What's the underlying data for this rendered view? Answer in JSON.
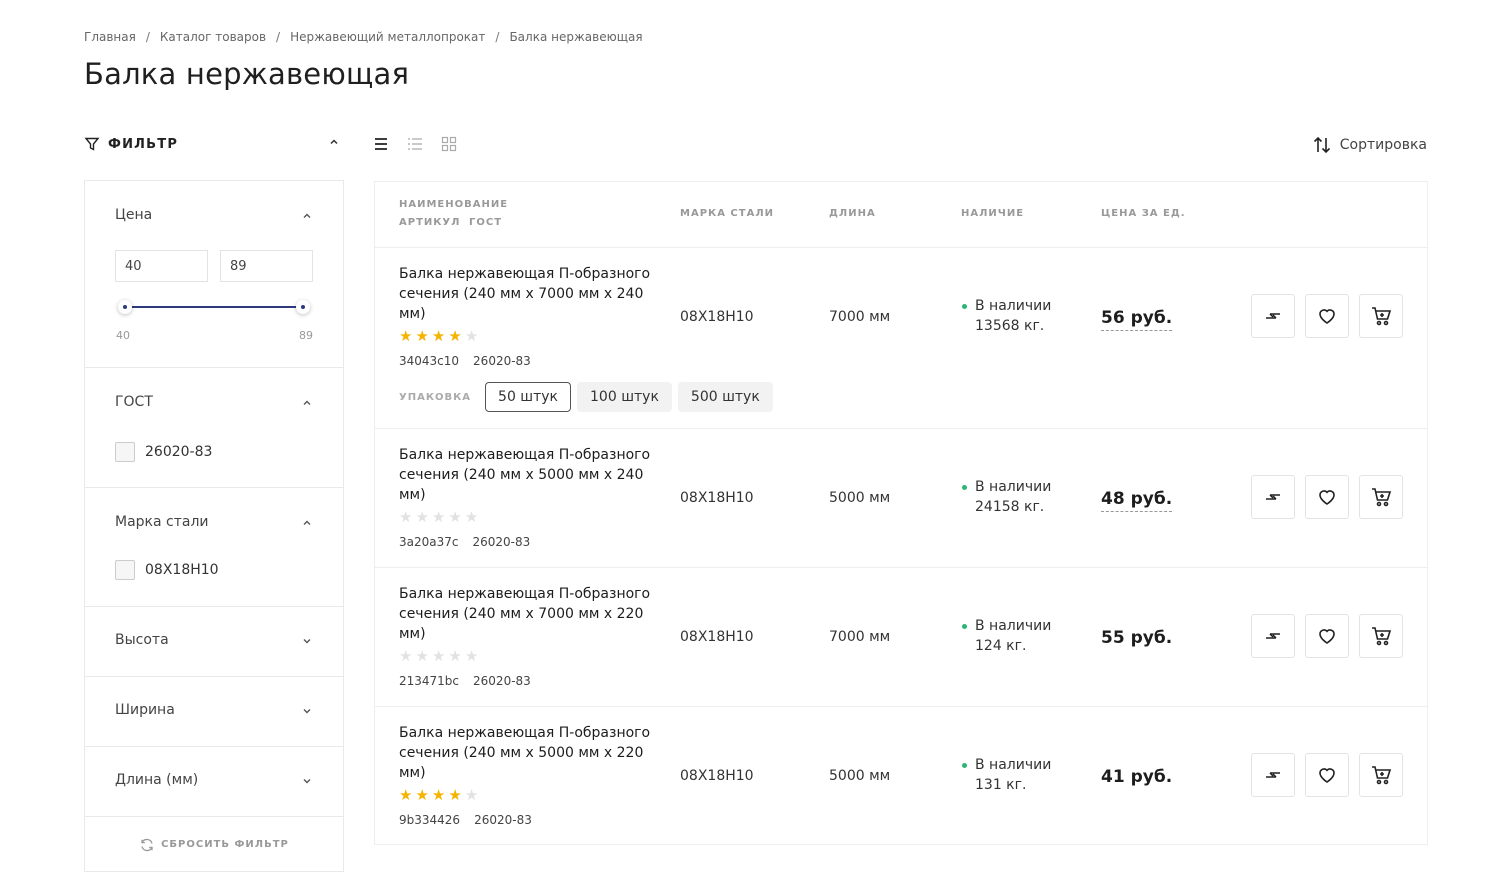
{
  "breadcrumbs": [
    "Главная",
    "Каталог товаров",
    "Нержавеющий металлопрокат",
    "Балка нержавеющая"
  ],
  "page_title": "Балка нержавеющая",
  "filter": {
    "title": "ФИЛЬТР",
    "price": {
      "title": "Цена",
      "min_value": "40",
      "max_value": "89",
      "range_min": "40",
      "range_max": "89"
    },
    "gost": {
      "title": "ГОСТ",
      "options": [
        "26020-83"
      ]
    },
    "steel": {
      "title": "Марка стали",
      "options": [
        "08Х18Н10"
      ]
    },
    "height": {
      "title": "Высота"
    },
    "width": {
      "title": "Ширина"
    },
    "length": {
      "title": "Длина (мм)"
    },
    "reset_label": "СБРОСИТЬ ФИЛЬТР"
  },
  "sort_label": "Сортировка",
  "table": {
    "headers": {
      "name": "НАИМЕНОВАНИЕ",
      "article": "АРТИКУЛ",
      "gost": "ГОСТ",
      "steel": "МАРКА СТАЛИ",
      "length": "ДЛИНА",
      "stock": "НАЛИЧИЕ",
      "price": "ЦЕНА ЗА ЕД."
    },
    "rows": [
      {
        "name": "Балка нержавеющая П-образного сечения (240 мм х 7000 мм х 240 мм)",
        "rating": 4,
        "article": "34043c10",
        "gost": "26020-83",
        "steel": "08Х18Н10",
        "length": "7000 мм",
        "stock_status": "В наличии",
        "stock_qty": "13568 кг.",
        "price": "56 руб.",
        "pack_label": "УПАКОВКА",
        "packs": [
          "50 штук",
          "100 штук",
          "500 штук"
        ]
      },
      {
        "name": "Балка нержавеющая П-образного сечения (240 мм х 5000 мм х 240 мм)",
        "rating": 0,
        "article": "3a20a37c",
        "gost": "26020-83",
        "steel": "08Х18Н10",
        "length": "5000 мм",
        "stock_status": "В наличии",
        "stock_qty": "24158 кг.",
        "price": "48 руб."
      },
      {
        "name": "Балка нержавеющая П-образного сечения (240 мм х 7000 мм х 220 мм)",
        "rating": 0,
        "article": "213471bc",
        "gost": "26020-83",
        "steel": "08Х18Н10",
        "length": "7000 мм",
        "stock_status": "В наличии",
        "stock_qty": "124 кг.",
        "price": "55 руб."
      },
      {
        "name": "Балка нержавеющая П-образного сечения (240 мм х 5000 мм х 220 мм)",
        "rating": 4,
        "article": "9b334426",
        "gost": "26020-83",
        "steel": "08Х18Н10",
        "length": "5000 мм",
        "stock_status": "В наличии",
        "stock_qty": "131 кг.",
        "price": "41 руб."
      }
    ]
  },
  "colors": {
    "accent": "#2d3a7c",
    "star": "#f4b400",
    "in_stock": "#2bb673"
  }
}
